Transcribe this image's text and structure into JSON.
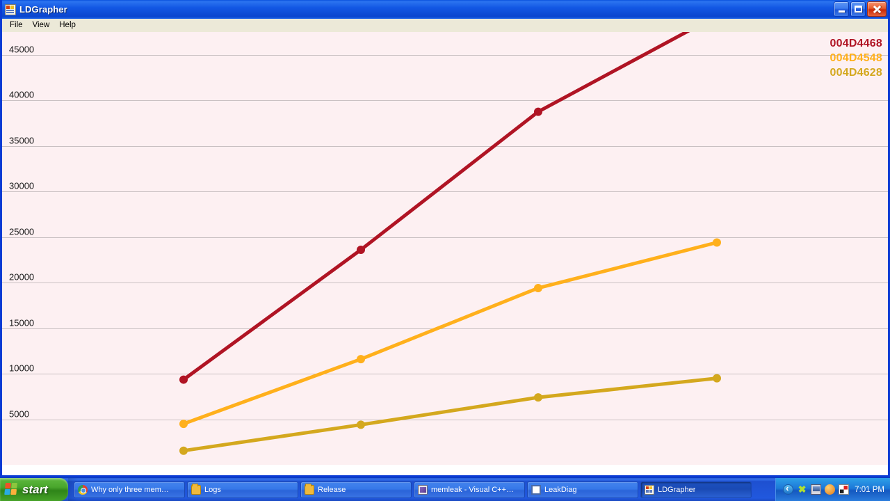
{
  "window": {
    "title": "LDGrapher",
    "icon": "app-grid-icon",
    "buttons": {
      "minimize": "Minimize",
      "maximize": "Maximize",
      "close": "Close"
    }
  },
  "menu": {
    "items": [
      {
        "label": "File"
      },
      {
        "label": "View"
      },
      {
        "label": "Help"
      }
    ]
  },
  "chart_data": {
    "type": "line",
    "title": "",
    "xlabel": "",
    "ylabel": "",
    "x": [
      1,
      2,
      3,
      4
    ],
    "ylim": [
      0,
      47500
    ],
    "yticks": [
      5000,
      10000,
      15000,
      20000,
      25000,
      30000,
      35000,
      40000,
      45000
    ],
    "ytick_labels": [
      "5000",
      "10000",
      "15000",
      "20000",
      "25000",
      "30000",
      "35000",
      "40000",
      "45000"
    ],
    "grid": true,
    "legend_position": "top-right",
    "plot_background": "#FDF0F2",
    "gridline_color": "#C9C0C2",
    "series": [
      {
        "name": "004D4468",
        "color": "#B01424",
        "values": [
          9350,
          23600,
          38750,
          49300
        ]
      },
      {
        "name": "004D4548",
        "color": "#FFB01C",
        "values": [
          4500,
          11600,
          19400,
          24400
        ]
      },
      {
        "name": "004D4628",
        "color": "#D4A81E",
        "values": [
          1550,
          4400,
          7400,
          9500
        ]
      }
    ]
  },
  "taskbar": {
    "start_label": "start",
    "tasks": [
      {
        "label": "Why only three mem…",
        "icon": "chrome-icon",
        "active": false
      },
      {
        "label": "Logs",
        "icon": "folder-icon",
        "active": false
      },
      {
        "label": "Release",
        "icon": "folder-icon",
        "active": false
      },
      {
        "label": "memleak - Visual C++…",
        "icon": "visual-studio-icon",
        "active": false
      },
      {
        "label": "LeakDiag",
        "icon": "window-icon",
        "active": false
      },
      {
        "label": "LDGrapher",
        "icon": "ldgrapher-icon",
        "active": true
      }
    ],
    "tray": {
      "icons": [
        "show-hidden-icons-arrow",
        "antivirus-icon",
        "network-icon",
        "update-icon",
        "kaspersky-icon"
      ],
      "clock": "7:01 PM"
    }
  }
}
